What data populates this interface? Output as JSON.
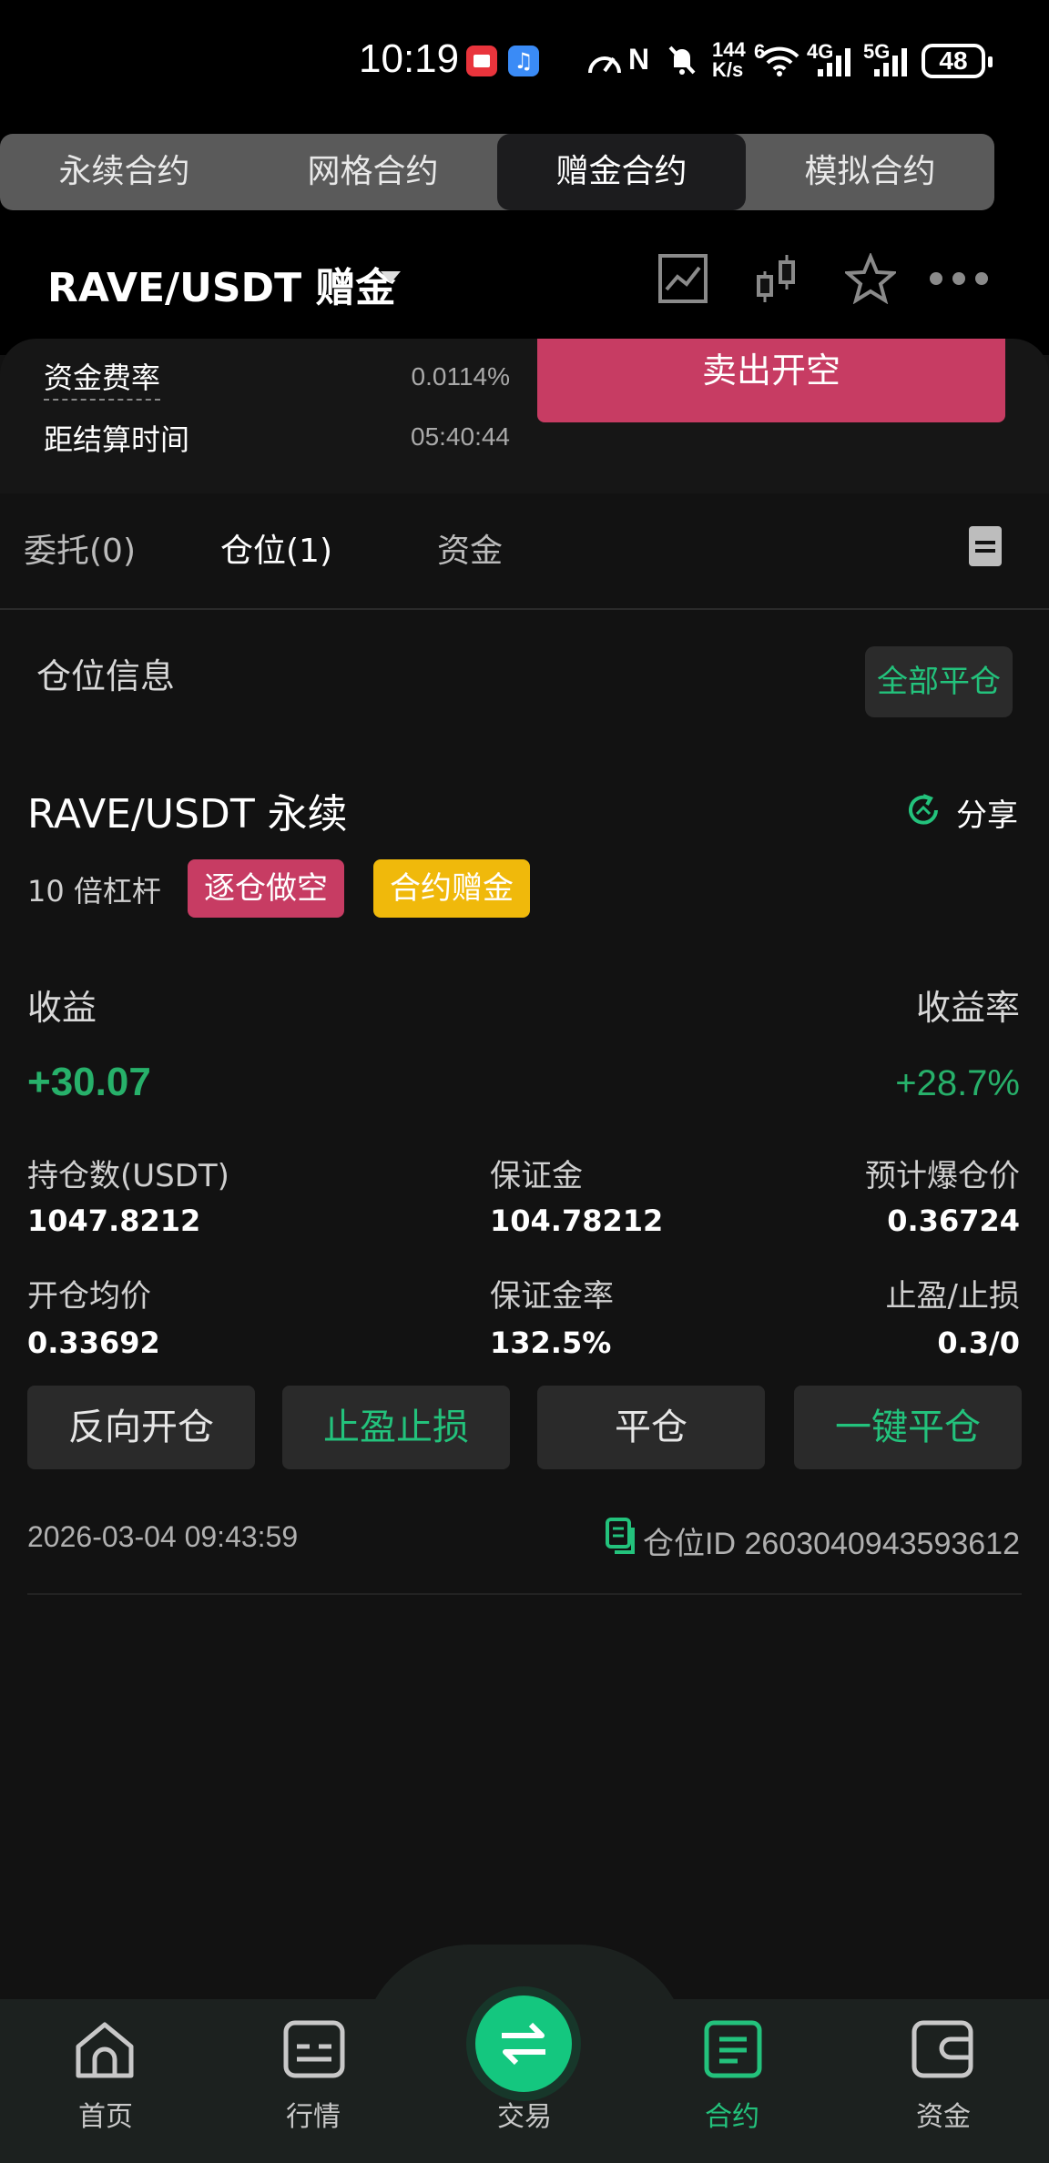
{
  "status_bar": {
    "time": "10:19",
    "net_speed": "144",
    "net_unit": "K/s",
    "sig1": "6",
    "sig2": "4G",
    "sig3": "5G",
    "battery": "48"
  },
  "segments": [
    {
      "label": "永续合约",
      "active": false
    },
    {
      "label": "网格合约",
      "active": false
    },
    {
      "label": "赠金合约",
      "active": true
    },
    {
      "label": "模拟合约",
      "active": false
    }
  ],
  "header": {
    "pair": "RAVE/USDT  赠金"
  },
  "info": {
    "funding_rate_label": "资金费率",
    "funding_rate": "0.0114%",
    "settle_label": "距结算时间",
    "settle_time": "05:40:44",
    "sell_button": "卖出开空"
  },
  "tabs": {
    "orders": "委托(0)",
    "positions": "仓位(1)",
    "funds": "资金"
  },
  "position": {
    "section_title": "仓位信息",
    "close_all": "全部平仓",
    "name": "RAVE/USDT 永续",
    "share": "分享",
    "leverage": "10 倍杠杆",
    "badge_mode": "逐仓做空",
    "badge_bonus": "合约赠金",
    "pnl_label": "收益",
    "pnl_rate_label": "收益率",
    "pnl": "+30.07",
    "pnl_rate": "+28.7%",
    "size_label": "持仓数(USDT)",
    "size": "1047.8212",
    "margin_label": "保证金",
    "margin": "104.78212",
    "liq_label": "预计爆仓价",
    "liq": "0.36724",
    "entry_label": "开仓均价",
    "entry": "0.33692",
    "margin_rate_label": "保证金率",
    "margin_rate": "132.5%",
    "tpsl_label": "止盈/止损",
    "tpsl": "0.3/0",
    "btn_reverse": "反向开仓",
    "btn_tpsl": "止盈止损",
    "btn_close": "平仓",
    "btn_quick_close": "一键平仓",
    "open_time": "2026-03-04 09:43:59",
    "position_id": "仓位ID 2603040943593612"
  },
  "nav": {
    "home": "首页",
    "market": "行情",
    "trade": "交易",
    "contract": "合约",
    "assets": "资金"
  },
  "colors": {
    "green": "#23c27c",
    "red": "#c73c63",
    "yellow": "#f0b90b"
  }
}
